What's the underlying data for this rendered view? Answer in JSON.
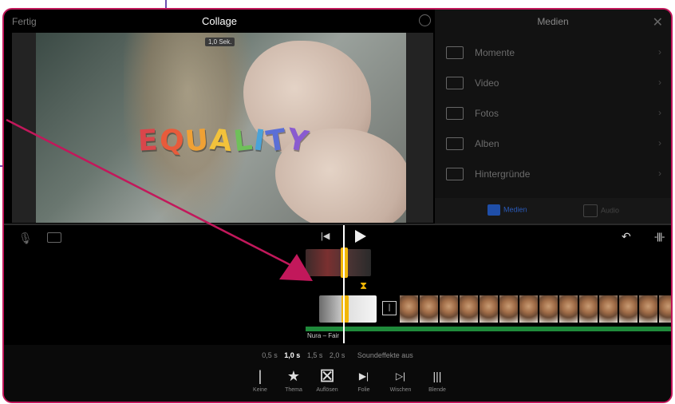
{
  "header": {
    "done_label": "Fertig",
    "title": "Collage",
    "settings_icon": "gear-icon"
  },
  "preview": {
    "duration_badge": "1,0 Sek.",
    "overlay_text_letters": [
      "E",
      "Q",
      "U",
      "A",
      "L",
      "I",
      "T",
      "Y"
    ],
    "letter_colors": [
      "#d9464b",
      "#e85b3b",
      "#f0a134",
      "#f2c23b",
      "#6fc05a",
      "#4aa3d8",
      "#5b6fd6",
      "#8a5bd0"
    ]
  },
  "media_panel": {
    "title": "Medien",
    "items": [
      {
        "label": "Momente",
        "icon": "moments-icon"
      },
      {
        "label": "Video",
        "icon": "film-icon"
      },
      {
        "label": "Fotos",
        "icon": "photo-icon"
      },
      {
        "label": "Alben",
        "icon": "album-icon"
      },
      {
        "label": "Hintergründe",
        "icon": "background-icon"
      }
    ],
    "tabs": [
      {
        "label": "Medien",
        "active": true
      },
      {
        "label": "Audio",
        "active": false
      }
    ]
  },
  "timeline": {
    "audio_clip_label": "Nura – Fair",
    "transition_marker": "|"
  },
  "transition_bar": {
    "durations": [
      "0,5 s",
      "1,0 s",
      "1,5 s",
      "2,0 s"
    ],
    "selected_duration": "1,0 s",
    "sound_effects_label": "Soundeffekte aus",
    "tools": [
      {
        "label": "Keine",
        "glyph": "|"
      },
      {
        "label": "Thema",
        "glyph": "★"
      },
      {
        "label": "Auflösen",
        "glyph": "⊠"
      },
      {
        "label": "Folie",
        "glyph": "▶|"
      },
      {
        "label": "Wischen",
        "glyph": "▷|"
      },
      {
        "label": "Blende",
        "glyph": "|||"
      }
    ]
  },
  "colors": {
    "accent": "#c2185b",
    "clip_handle": "#f2b705",
    "audio_track": "#1f8a3b",
    "media_tab_active": "#1f4ea8"
  }
}
